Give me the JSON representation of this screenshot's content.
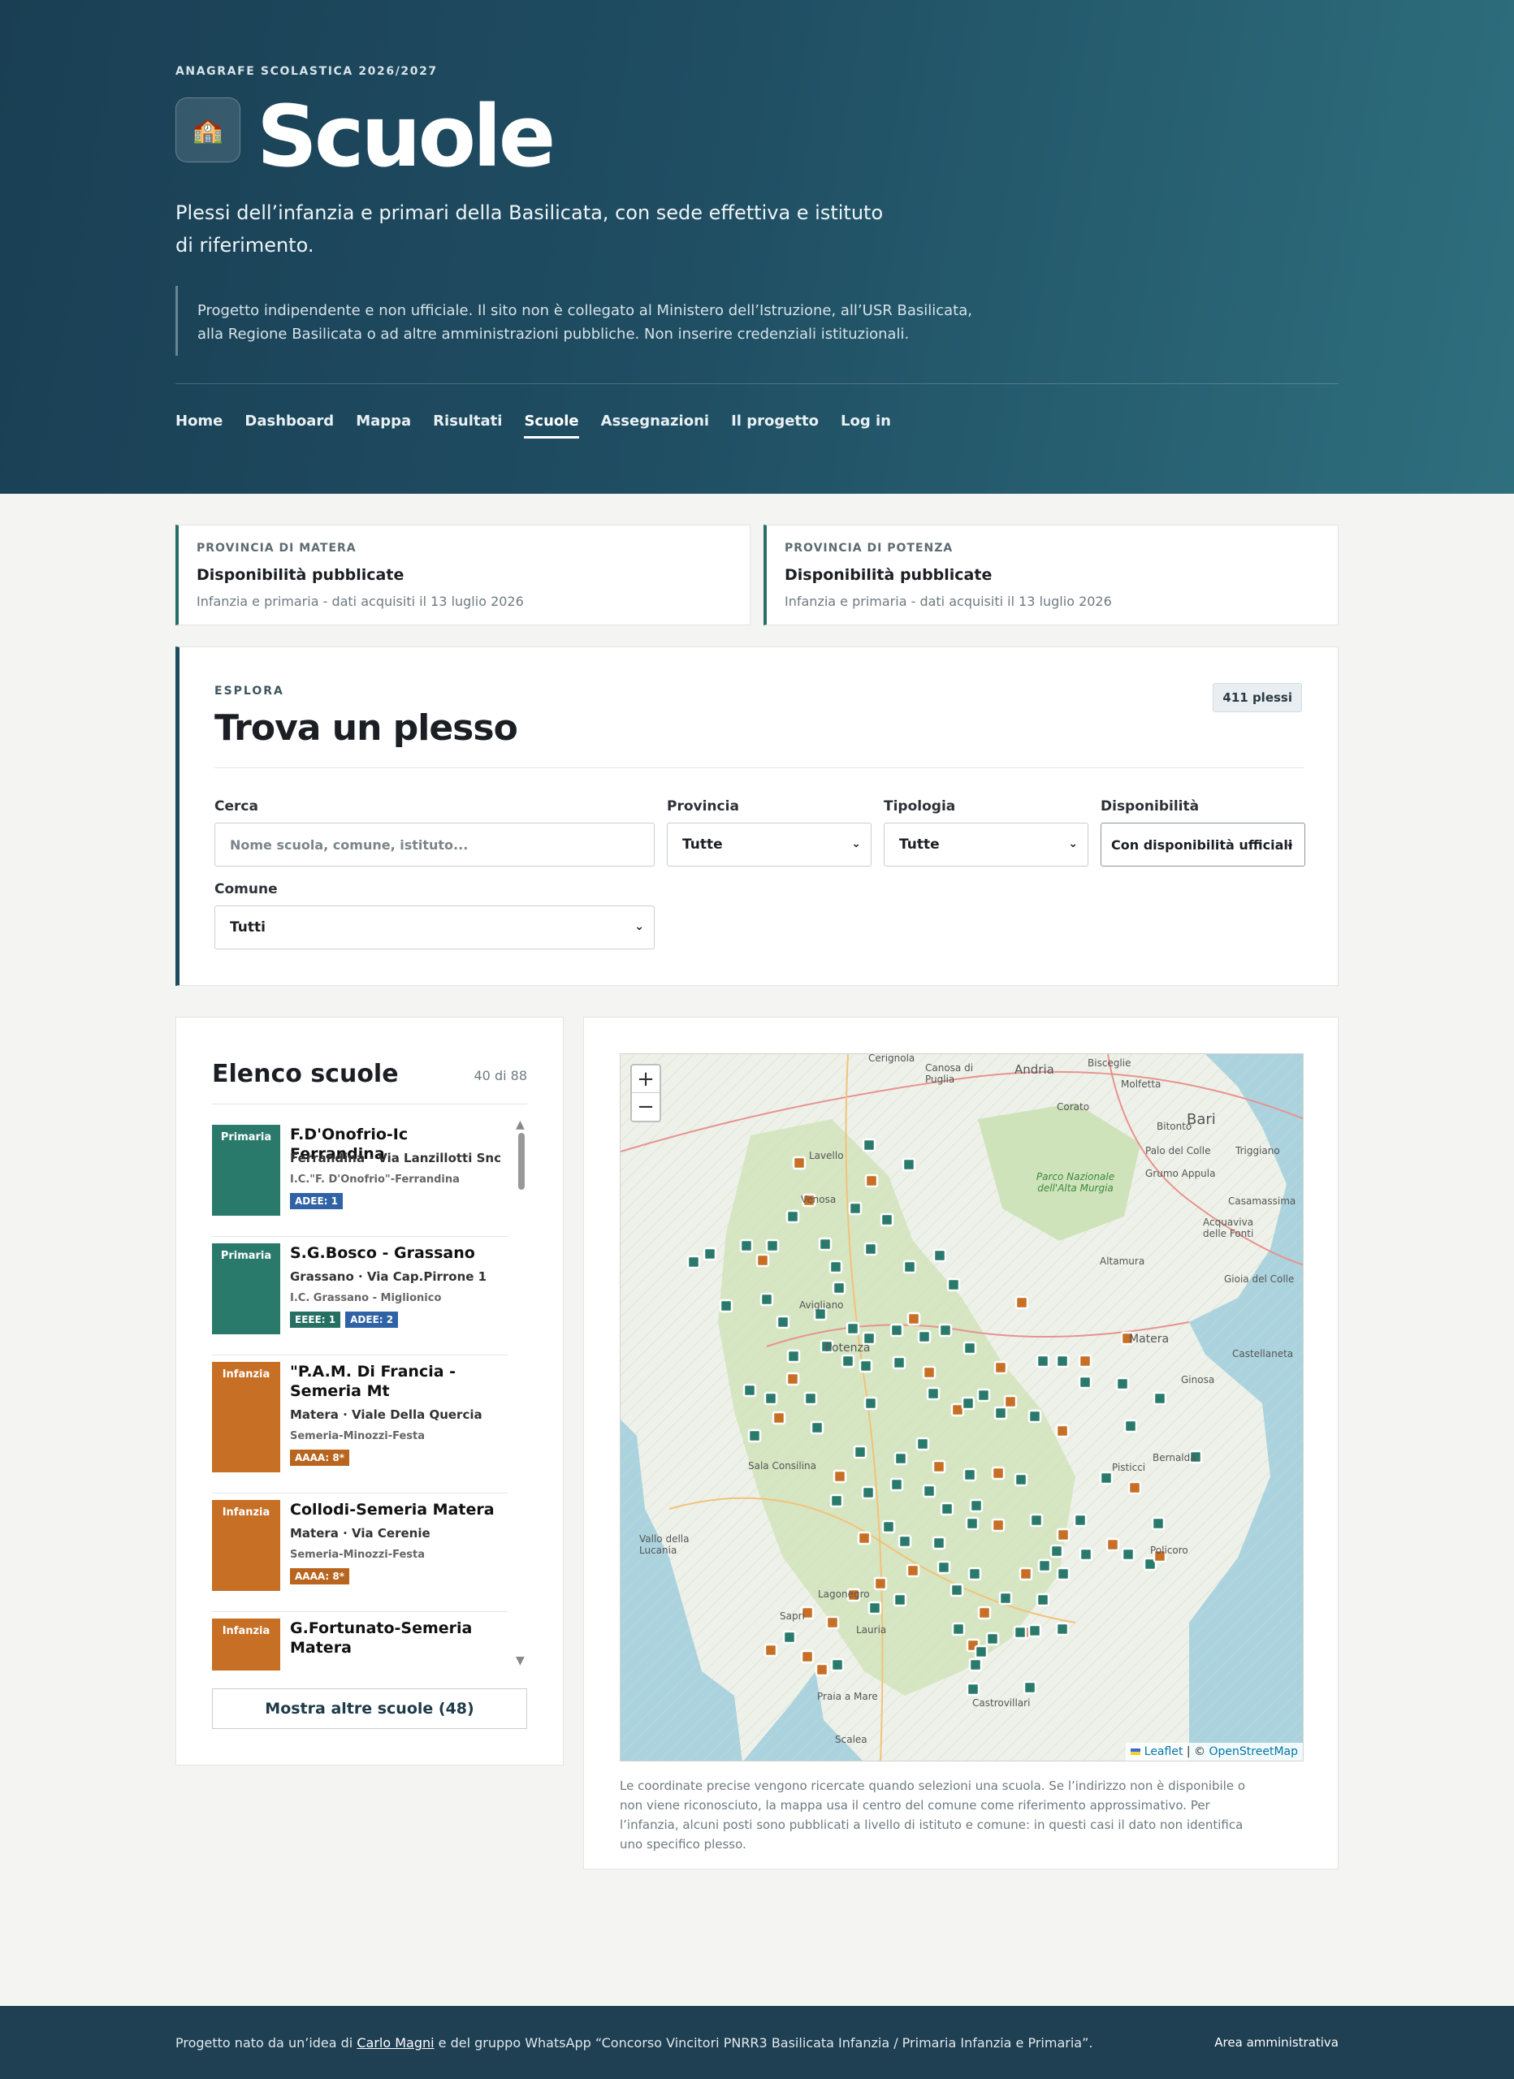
{
  "header": {
    "eyebrow": "ANAGRAFE SCOLASTICA 2026/2027",
    "title": "Scuole",
    "lede": "Plessi dell’infanzia e primari della Basilicata, con sede effettiva e istituto di riferimento.",
    "disclaimer": "Progetto indipendente e non ufficiale. Il sito non è collegato al Ministero dell’Istruzione, all’USR Basilicata, alla Regione Basilicata o ad altre amministrazioni pubbliche. Non inserire credenziali istituzionali."
  },
  "nav": [
    "Home",
    "Dashboard",
    "Mappa",
    "Risultati",
    "Scuole",
    "Assegnazioni",
    "Il progetto",
    "Log in"
  ],
  "nav_active": "Scuole",
  "provinces": [
    {
      "kicker": "PROVINCIA DI MATERA",
      "heading": "Disponibilità pubblicate",
      "sub": "Infanzia e primaria - dati acquisiti il 13 luglio 2026"
    },
    {
      "kicker": "PROVINCIA DI POTENZA",
      "heading": "Disponibilità pubblicate",
      "sub": "Infanzia e primaria - dati acquisiti il 13 luglio 2026"
    }
  ],
  "explore": {
    "kicker": "ESPLORA",
    "title": "Trova un plesso",
    "count": "411 plessi",
    "search_label": "Cerca",
    "search_placeholder": "Nome scuola, comune, istituto...",
    "provincia_label": "Provincia",
    "provincia_value": "Tutte",
    "tipologia_label": "Tipologia",
    "tipologia_value": "Tutte",
    "disponibilita_label": "Disponibilità",
    "disponibilita_value": "Con disponibilità ufficiali",
    "comune_label": "Comune",
    "comune_value": "Tutti"
  },
  "list": {
    "title": "Elenco scuole",
    "count": "40 di 88",
    "more": "Mostra altre scuole (48)",
    "items": [
      {
        "type": "Primaria",
        "name": "F.D'Onofrio-Ic Ferrandina",
        "loc": "Ferrandina · Via Lanzillotti Snc",
        "inst": "I.C.\"F. D'Onofrio\"-Ferrandina",
        "pills": [
          "ADEE: 1"
        ]
      },
      {
        "type": "Primaria",
        "name": "S.G.Bosco - Grassano",
        "loc": "Grassano · Via Cap.Pirrone 1",
        "inst": "I.C. Grassano - Miglionico",
        "pills": [
          "EEEE: 1",
          "ADEE: 2"
        ]
      },
      {
        "type": "Infanzia",
        "name": "\"P.A.M. Di Francia - Semeria Mt",
        "loc": "Matera · Viale Della Quercia",
        "inst": "Semeria-Minozzi-Festa",
        "pills": [
          "AAAA: 8*"
        ]
      },
      {
        "type": "Infanzia",
        "name": "Collodi-Semeria Matera",
        "loc": "Matera · Via Cerenie",
        "inst": "Semeria-Minozzi-Festa",
        "pills": [
          "AAAA: 8*"
        ]
      },
      {
        "type": "Infanzia",
        "name": "G.Fortunato-Semeria Matera",
        "loc": "",
        "inst": "",
        "pills": []
      }
    ]
  },
  "map": {
    "zoom_in": "+",
    "zoom_out": "−",
    "attribution_leaflet": "Leaflet",
    "attribution_sep": " | © ",
    "attribution_osm": "OpenStreetMap",
    "note": "Le coordinate precise vengono ricercate quando selezioni una scuola. Se l’indirizzo non è disponibile o non viene riconosciuto, la mappa usa il centro del comune come riferimento approssimativo. Per l’infanzia, alcuni posti sono pubblicati a livello di istituto e comune: in questi casi il dato non identifica uno specifico plesso.",
    "places": [
      "Andria",
      "Bari",
      "Potenza",
      "Matera",
      "Altamura",
      "Cerignola",
      "Canosa di Puglia",
      "Bisceglie",
      "Molfetta",
      "Corato",
      "Bitonto",
      "Palo del Colle",
      "Grumo Appula",
      "Triggiano",
      "Casamassima",
      "Acquaviva delle Fonti",
      "Gioia del Colle",
      "Castellaneta",
      "Ginosa",
      "Bernalda",
      "Pisticci",
      "Policoro",
      "Sala Consilina",
      "Vallo della Lucania",
      "Sapri",
      "Lagonegro",
      "Lauria",
      "Praia a Mare",
      "Scalea",
      "Castrovillari",
      "Venosa",
      "Lavello",
      "Avigliano",
      "Parco Nazionale dell'Alta Murgia"
    ]
  },
  "footer": {
    "pre": "Progetto nato da un’idea di ",
    "author": "Carlo Magni",
    "post": " e del gruppo WhatsApp “Concorso Vincitori PNRR3 Basilicata Infanzia / Primaria Infanzia e Primaria”.",
    "admin": "Area amministrativa"
  },
  "colors": {
    "primaria": "#2a7a6c",
    "infanzia": "#c76f25",
    "adee": "#2f63a6",
    "eeee": "#257063",
    "aaaa": "#b8661f",
    "accent": "#1f4b5e"
  }
}
